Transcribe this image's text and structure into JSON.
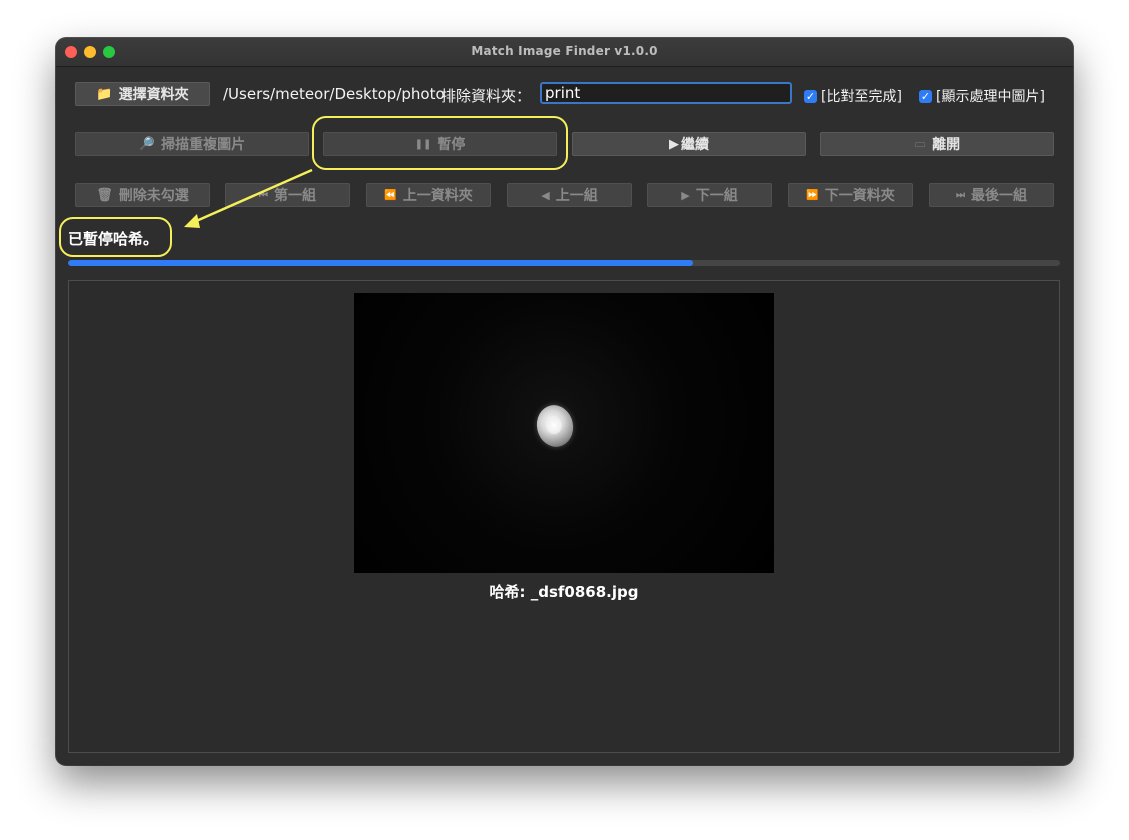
{
  "window": {
    "title": "Match Image Finder v1.0.0"
  },
  "toolbar": {
    "choose_folder_label": "選擇資料夾",
    "folder_path": "/Users/meteor/Desktop/photo",
    "exclude_label": "排除資料夾：",
    "exclude_value": "print",
    "compare_to_complete_label": "[比對至完成]",
    "compare_to_complete_checked": true,
    "show_processing_label": "[顯示處理中圖片]",
    "show_processing_checked": true
  },
  "actions": {
    "scan_label": "掃描重複圖片",
    "pause_label": "暫停",
    "resume_label": "繼續",
    "exit_label": "離開"
  },
  "navigation": {
    "delete_unchecked_label": "刪除未勾選",
    "first_group_label": "第一組",
    "prev_folder_label": "上一資料夾",
    "prev_group_label": "上一組",
    "next_group_label": "下一組",
    "next_folder_label": "下一資料夾",
    "last_group_label": "最後一組"
  },
  "status": {
    "text": "已暫停哈希。"
  },
  "progress": {
    "percent": 63
  },
  "preview": {
    "caption": "哈希: _dsf0868.jpg"
  },
  "icons": {
    "folder": "folder-icon",
    "scan": "magnifier-icon",
    "pause": "pause-icon",
    "play": "play-icon",
    "exit": "door-icon",
    "trash": "trash-icon",
    "first": "skip-to-first-icon",
    "rewind": "rewind-icon",
    "prev": "previous-icon",
    "next": "next-icon",
    "forward": "fast-forward-icon",
    "last": "skip-to-last-icon"
  },
  "colors": {
    "accent": "#2f7cf6",
    "annotation": "#f5ef5a",
    "window_bg": "#2e2e2e"
  }
}
